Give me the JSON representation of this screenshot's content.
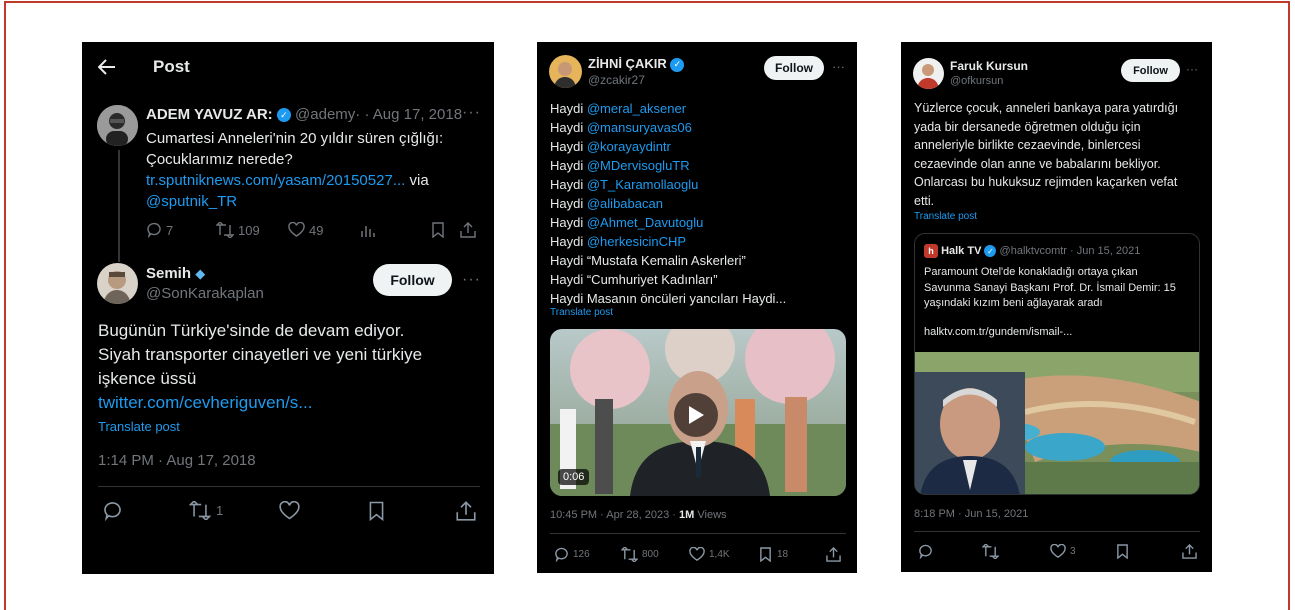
{
  "p1": {
    "header_title": "Post",
    "quoted": {
      "name": "ADEM YAVUZ AR:",
      "handle": "@ademy·",
      "date": "· Aug 17, 2018",
      "text1": "Cumartesi Anneleri'nin 20 yıldır süren çığlığı:",
      "text2": "Çocuklarımız nerede?",
      "link": "tr.sputniknews.com/yasam/20150527...",
      "via": " via",
      "mention": "@sputnik_TR",
      "replies": "7",
      "retweets": "109",
      "likes": "49"
    },
    "reply": {
      "name": "Semih",
      "handle": "@SonKarakaplan",
      "follow": "Follow",
      "text1": "Bugünün Türkiye'sinde de devam ediyor.",
      "text2": "Siyah transporter cinayetleri ve yeni türkiye",
      "text3": "işkence üssü",
      "link": "twitter.com/cevheriguven/s...",
      "translate": "Translate post",
      "timestamp": "1:14 PM · Aug 17, 2018",
      "retweets": "1"
    }
  },
  "p2": {
    "name": "ZİHNİ ÇAKIR",
    "handle": "@zcakir27",
    "follow": "Follow",
    "lines": [
      {
        "pre": "Haydi ",
        "link": "@meral_aksener"
      },
      {
        "pre": "Haydi ",
        "link": "@mansuryavas06"
      },
      {
        "pre": "Haydi ",
        "link": "@korayaydintr"
      },
      {
        "pre": "Haydi ",
        "link": "@MDervisogluTR"
      },
      {
        "pre": "Haydi ",
        "link": "@T_Karamollaoglu"
      },
      {
        "pre": "Haydi ",
        "link": "@alibabacan"
      },
      {
        "pre": "Haydi ",
        "link": "@Ahmet_Davutoglu"
      },
      {
        "pre": "Haydi ",
        "link": "@herkesicinCHP"
      }
    ],
    "plain1": "Haydi “Mustafa Kemalin Askerleri”",
    "plain2": "Haydi “Cumhuriyet Kadınları”",
    "plain3": "Haydi Masanın öncüleri yancıları Haydi...",
    "translate": "Translate post",
    "video_time": "0:06",
    "timestamp": "10:45 PM · Apr 28, 2023 · ",
    "views_count": "1M",
    "views_label": " Views",
    "replies": "126",
    "retweets": "800",
    "likes": "1,4K",
    "bookmarks": "18"
  },
  "p3": {
    "name": "Faruk Kursun",
    "handle": "@ofkursun",
    "follow": "Follow",
    "text": [
      "Yüzlerce çocuk, anneleri bankaya para yatırdığı",
      "yada bir dersanede öğretmen olduğu için",
      "anneleriyle birlikte  cezaevinde, binlercesi",
      "cezaevinde olan anne ve babalarını bekliyor.",
      "Onlarcası bu hukuksuz rejimden kaçarken vefat",
      "etti."
    ],
    "translate": "Translate post",
    "quoted": {
      "name": "Halk TV",
      "handle": "@halktvcomtr",
      "date": "· Jun 15, 2021",
      "text": [
        "Paramount Otel'de konakladığı ortaya çıkan",
        "Savunma Sanayi Başkanı Prof. Dr. İsmail Demir: 15",
        "yaşındaki kızım beni ağlayarak aradı"
      ],
      "link": "halktv.com.tr/gundem/ismail-..."
    },
    "timestamp": "8:18 PM · Jun 15, 2021",
    "likes": "3"
  }
}
